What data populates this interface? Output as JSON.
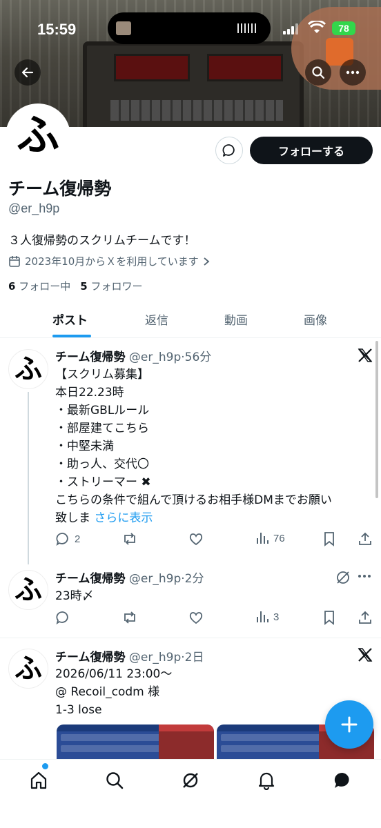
{
  "status": {
    "time": "15:59",
    "battery": "78"
  },
  "profile": {
    "avatar_char": "ふ",
    "name": "チーム復帰勢",
    "handle": "@er_h9p",
    "bio": "３人復帰勢のスクリムチームです！",
    "joined": "2023年10月からＸを利用しています",
    "following_count": "6",
    "following_label": "フォロー中",
    "followers_count": "5",
    "followers_label": "フォロワー",
    "follow_label": "フォローする"
  },
  "tabs": [
    {
      "label": "ポスト",
      "active": true
    },
    {
      "label": "返信",
      "active": false
    },
    {
      "label": "動画",
      "active": false
    },
    {
      "label": "画像",
      "active": false
    }
  ],
  "posts": [
    {
      "name": "チーム復帰勢",
      "meta": "@er_h9p·56分",
      "lines": [
        "【スクリム募集】",
        "本日22.23時",
        "・最新GBLルール",
        "・部屋建てこちら",
        "・中堅未満",
        "・助っ人、交代〇",
        "・ストリーマー ✖",
        "こちらの条件で組んで頂けるお相手様DMまでお願い",
        "致しま"
      ],
      "more": "さらに表示",
      "replies": "2",
      "views": "76"
    },
    {
      "name": "チーム復帰勢",
      "meta": "@er_h9p·2分",
      "lines": [
        "23時〆"
      ],
      "replies": "",
      "views": "3"
    },
    {
      "name": "チーム復帰勢",
      "meta": "@er_h9p·2日",
      "lines": [
        "2026/06/11 23:00〜",
        "@ Recoil_codm 様",
        "1-3 lose"
      ]
    }
  ],
  "colors": {
    "accent": "#1d9bf0",
    "text": "#0f1419",
    "muted": "#536471"
  }
}
